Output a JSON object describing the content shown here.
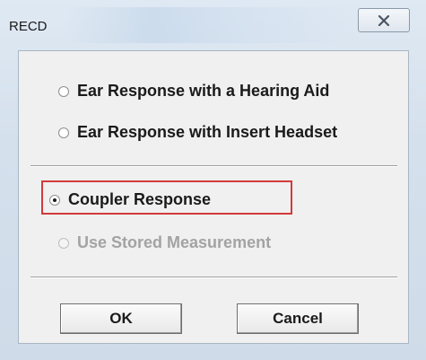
{
  "window": {
    "title": "RECD",
    "close_icon": "close-x-icon"
  },
  "options": {
    "ear_hearing_aid": {
      "label": "Ear Response with a Hearing Aid",
      "checked": false,
      "enabled": true
    },
    "ear_insert_headset": {
      "label": "Ear Response with Insert Headset",
      "checked": false,
      "enabled": true
    },
    "coupler_response": {
      "label": "Coupler Response",
      "checked": true,
      "enabled": true
    },
    "stored_measurement": {
      "label": "Use Stored Measurement",
      "checked": false,
      "enabled": false
    }
  },
  "buttons": {
    "ok_label": "OK",
    "cancel_label": "Cancel"
  },
  "colors": {
    "highlight": "#d23a3a",
    "disabled_text": "#a3a3a3"
  }
}
